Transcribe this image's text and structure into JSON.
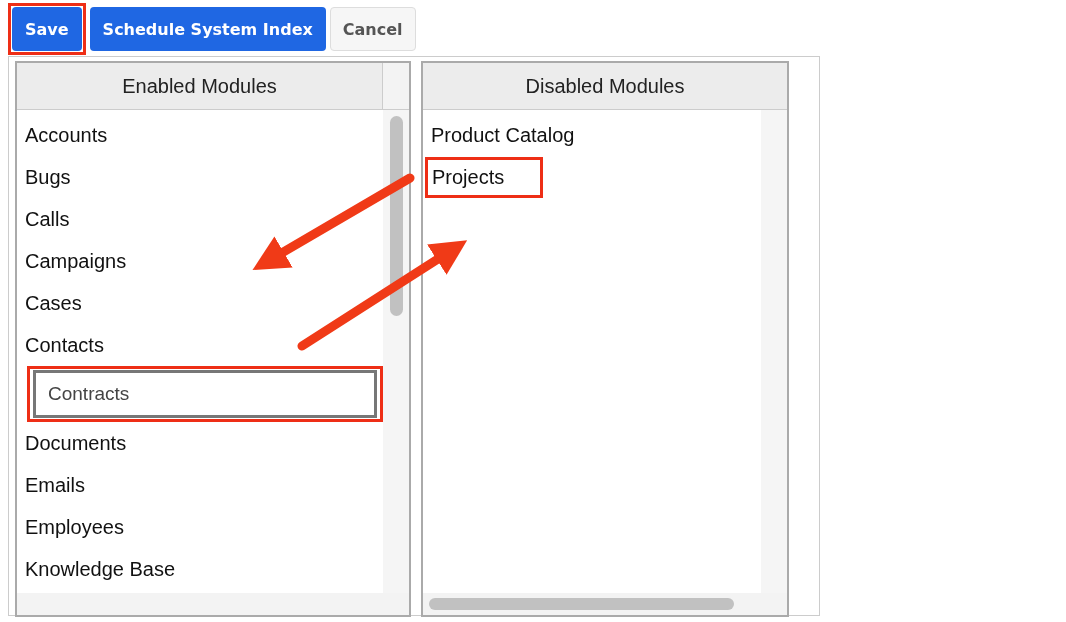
{
  "buttons": [
    {
      "label": "Save",
      "kind": "primary",
      "highlighted": true
    },
    {
      "label": "Schedule System Index",
      "kind": "primary",
      "highlighted": false
    },
    {
      "label": "Cancel",
      "kind": "secondary",
      "highlighted": false
    }
  ],
  "enabled_modules": {
    "title": "Enabled Modules",
    "items": [
      {
        "label": "Accounts",
        "kind": "item",
        "highlighted": false
      },
      {
        "label": "Bugs",
        "kind": "item",
        "highlighted": false
      },
      {
        "label": "Calls",
        "kind": "item",
        "highlighted": false
      },
      {
        "label": "Campaigns",
        "kind": "item",
        "highlighted": false
      },
      {
        "label": "Cases",
        "kind": "item",
        "highlighted": false
      },
      {
        "label": "Contacts",
        "kind": "item",
        "highlighted": false
      },
      {
        "label": "Contracts",
        "kind": "dragged",
        "highlighted": true
      },
      {
        "label": "Documents",
        "kind": "item",
        "highlighted": false
      },
      {
        "label": "Emails",
        "kind": "item",
        "highlighted": false
      },
      {
        "label": "Employees",
        "kind": "item",
        "highlighted": false
      },
      {
        "label": "Knowledge Base",
        "kind": "item",
        "highlighted": false
      }
    ]
  },
  "disabled_modules": {
    "title": "Disabled Modules",
    "items": [
      {
        "label": "Product Catalog",
        "kind": "item",
        "highlighted": false
      },
      {
        "label": "Projects",
        "kind": "item",
        "highlighted": true
      }
    ]
  }
}
